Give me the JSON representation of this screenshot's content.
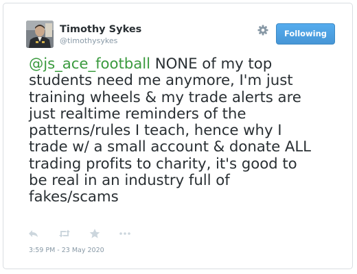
{
  "author": {
    "name": "Timothy Sykes",
    "handle": "@timothysykes",
    "avatar": "avatar-photo"
  },
  "header": {
    "settings_icon": "gear-icon",
    "follow_button_label": "Following"
  },
  "tweet": {
    "mention": "@js_ace_football",
    "body_lines": [
      " NONE of my top",
      "students need me anymore, I'm just",
      "training wheels & my trade alerts are",
      "just realtime reminders of the",
      "patterns/rules I teach, hence why I",
      "trade w/ a small account & donate ALL",
      "trading profits to charity, it's good to",
      "be real in an industry full of",
      "fakes/scams"
    ]
  },
  "actions": [
    {
      "name": "reply",
      "icon": "reply-icon"
    },
    {
      "name": "retweet",
      "icon": "retweet-icon"
    },
    {
      "name": "like",
      "icon": "star-icon"
    },
    {
      "name": "more",
      "icon": "more-icon"
    }
  ],
  "timestamp": "3:59 PM - 23 May 2020",
  "colors": {
    "mention": "#3a9a3e",
    "follow_button": "#55acee",
    "text": "#292f33",
    "muted": "#8899a6",
    "action_icons": "#ccd6dd"
  }
}
